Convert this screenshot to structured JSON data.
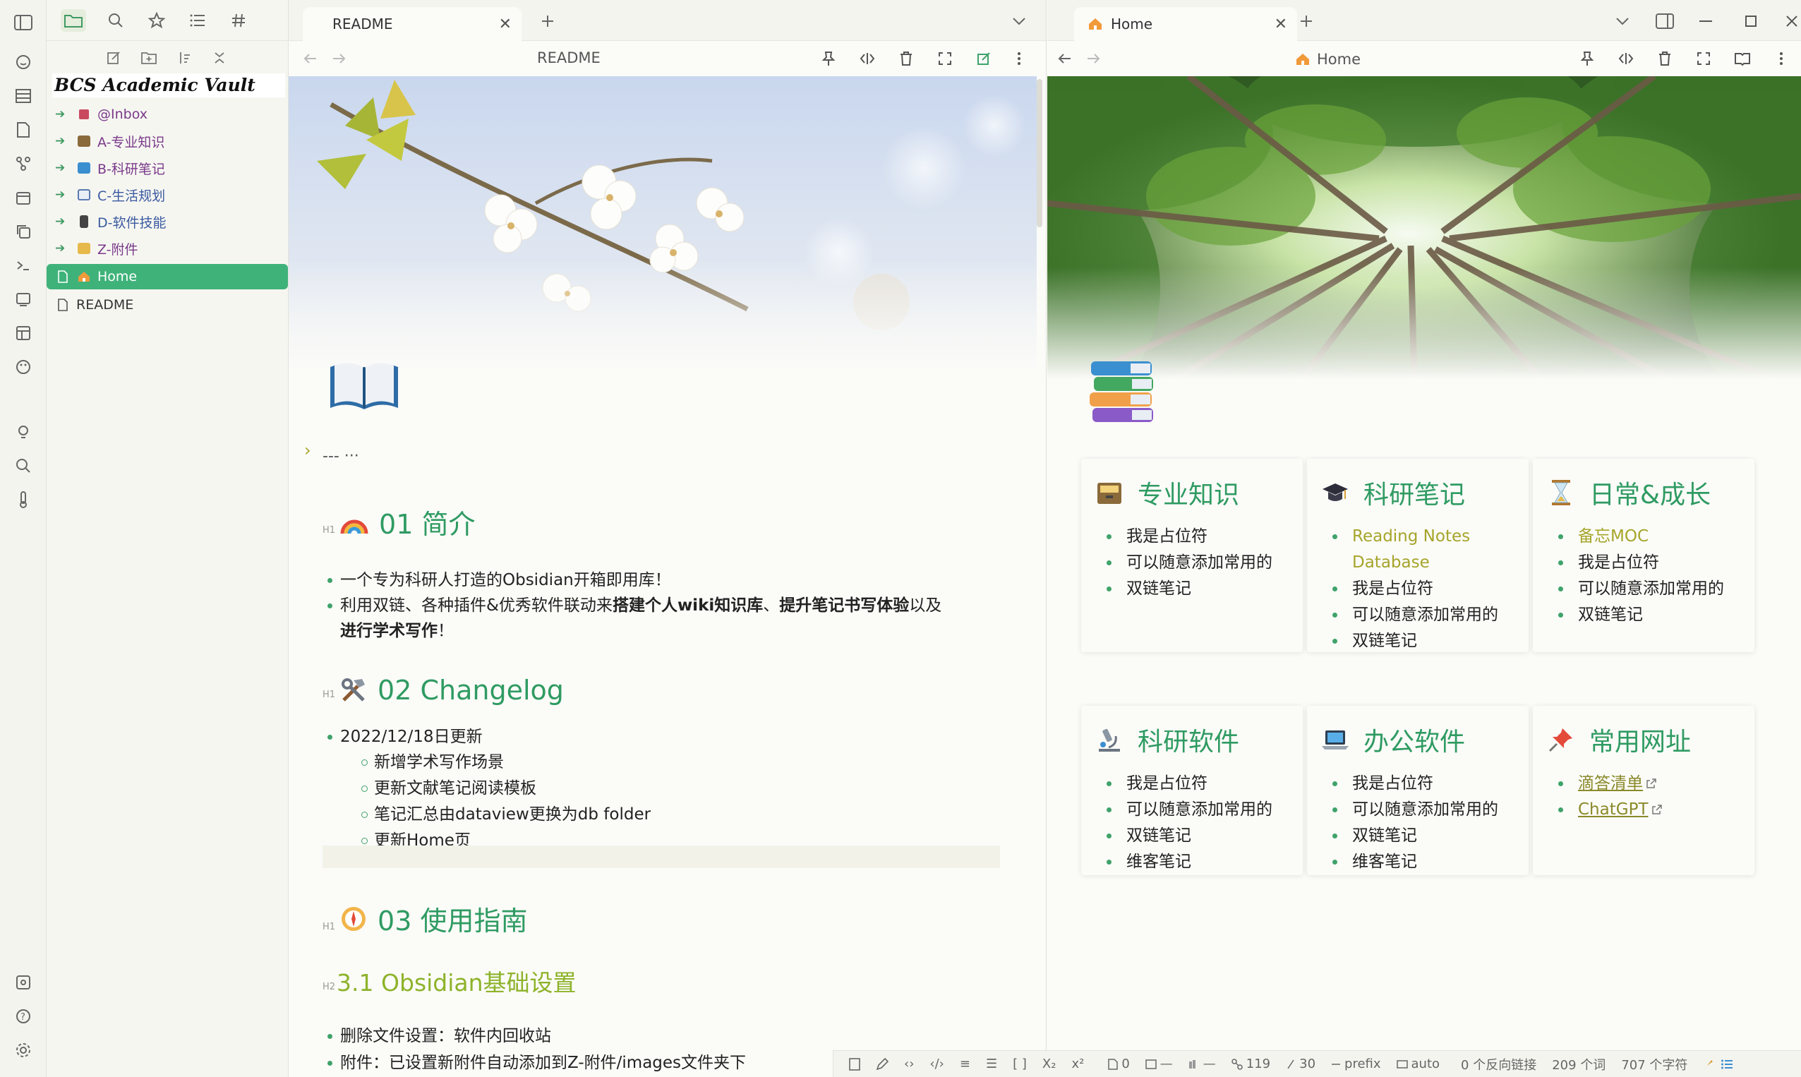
{
  "sidebar": {
    "vault_name": "BCS Academic Vault",
    "tree": [
      {
        "label": "@Inbox",
        "color": "#7a3a8a",
        "icon": "inbox-icon"
      },
      {
        "label": "A-专业知识",
        "color": "#7a3a8a",
        "icon": "folder-knowledge-icon"
      },
      {
        "label": "B-科研笔记",
        "color": "#7a3a8a",
        "icon": "folder-notes-icon"
      },
      {
        "label": "C-生活规划",
        "color": "#3a5aa0",
        "icon": "calendar-icon"
      },
      {
        "label": "D-软件技能",
        "color": "#3a5aa0",
        "icon": "phone-icon"
      },
      {
        "label": "Z-附件",
        "color": "#7a3a8a",
        "icon": "folder-icon"
      }
    ],
    "files": [
      {
        "label": "Home",
        "selected": true
      },
      {
        "label": "README",
        "selected": false
      }
    ]
  },
  "left_pane": {
    "tab_title": "README",
    "view_title": "README",
    "frontmatter": "--- ···",
    "sections": {
      "intro_heading": "01 简介",
      "intro_bullets": [
        "一个专为科研人打造的Obsidian开箱即用库！",
        "利用双链、各种插件&优秀软件联动来",
        "搭建个人wiki知识库",
        "、",
        "提升笔记书写体验",
        "以及",
        "进行学术写作",
        "！"
      ],
      "changelog_heading": "02 Changelog",
      "changelog_date": "2022/12/18日更新",
      "changelog_items": [
        "新增学术写作场景",
        "更新文献笔记阅读模板",
        "笔记汇总由dataview更换为db folder",
        "更新Home页"
      ],
      "guide_heading": "03 使用指南",
      "h2_heading": "3.1 Obsidian基础设置",
      "guide_bullets": [
        "删除文件设置：软件内回收站",
        "附件：已设置新附件自动添加到Z-附件/images文件夹下"
      ],
      "h1_mark": "H1",
      "h2_mark": "H2"
    }
  },
  "right_pane": {
    "tab_title": "Home",
    "view_title": "Home",
    "cards": [
      {
        "title": "专业知识",
        "icon": "card-file-box-icon",
        "items": [
          {
            "text": "我是占位符"
          },
          {
            "text": "可以随意添加常用的"
          },
          {
            "text": "双链笔记"
          }
        ]
      },
      {
        "title": "科研笔记",
        "icon": "graduation-cap-icon",
        "items": [
          {
            "text": "Reading Notes Database",
            "link": true
          },
          {
            "text": "我是占位符"
          },
          {
            "text": "可以随意添加常用的"
          },
          {
            "text": "双链笔记"
          }
        ]
      },
      {
        "title": "日常&成长",
        "icon": "hourglass-icon",
        "items": [
          {
            "text": "备忘MOC",
            "link": true
          },
          {
            "text": "我是占位符"
          },
          {
            "text": "可以随意添加常用的"
          },
          {
            "text": "双链笔记"
          }
        ]
      },
      {
        "title": "科研软件",
        "icon": "microscope-icon",
        "items": [
          {
            "text": "我是占位符"
          },
          {
            "text": "可以随意添加常用的"
          },
          {
            "text": "双链笔记"
          },
          {
            "text": "维客笔记"
          }
        ]
      },
      {
        "title": "办公软件",
        "icon": "laptop-icon",
        "items": [
          {
            "text": "我是占位符"
          },
          {
            "text": "可以随意添加常用的"
          },
          {
            "text": "双链笔记"
          },
          {
            "text": "维客笔记"
          }
        ]
      },
      {
        "title": "常用网址",
        "icon": "pushpin-icon",
        "items": [
          {
            "text": "滴答清单",
            "external": true
          },
          {
            "text": "ChatGPT",
            "external": true
          }
        ]
      }
    ]
  },
  "status_bar": {
    "items": [
      "0",
      "—",
      "—",
      "119",
      "30",
      "prefix",
      "auto"
    ],
    "backlinks": "0 个反向链接",
    "words": "209 个词",
    "chars": "707 个字符"
  },
  "colors": {
    "accent": "#3fb27a",
    "heading": "#2f9b62",
    "link": "#a6a52a"
  }
}
